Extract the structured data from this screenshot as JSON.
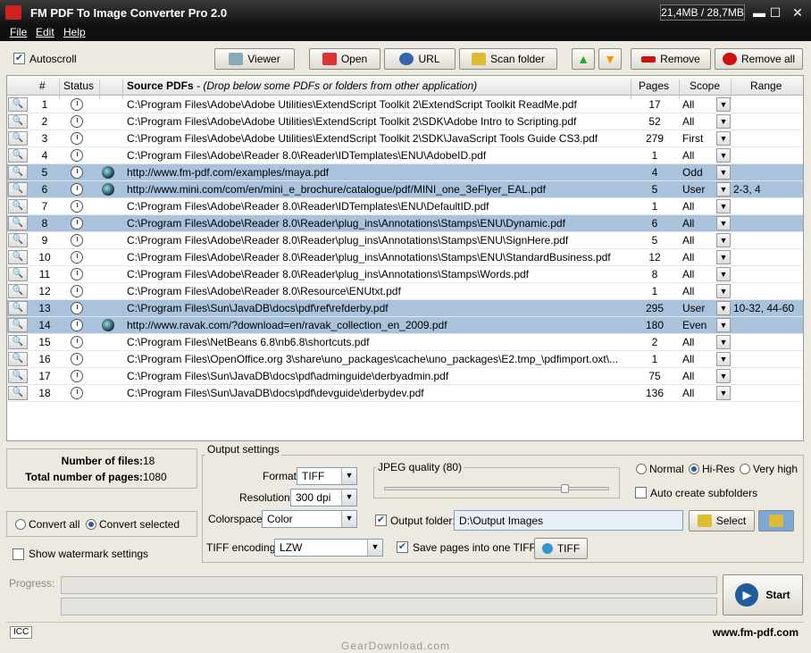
{
  "titlebar": {
    "title": "FM PDF To Image Converter Pro 2.0",
    "memory": "21,4MB / 28,7MB",
    "minimize": "▬",
    "maximize": "☐",
    "close": "✕"
  },
  "menu": {
    "file": "File",
    "edit": "Edit",
    "help": "Help"
  },
  "toolbar": {
    "autoscroll": "Autoscroll",
    "viewer": "Viewer",
    "open": "Open",
    "url": "URL",
    "scan_folder": "Scan folder",
    "move_up": "▲",
    "move_down": "▼",
    "remove": "Remove",
    "remove_all": "Remove all"
  },
  "grid": {
    "headers": {
      "num": "#",
      "status": "Status",
      "source": "Source PDFs",
      "hint": " - (Drop below some PDFs or folders from other application)",
      "pages": "Pages",
      "scope": "Scope",
      "range": "Range"
    },
    "rows": [
      {
        "num": "1",
        "path": "C:\\Program Files\\Adobe\\Adobe Utilities\\ExtendScript Toolkit 2\\ExtendScript Toolkit ReadMe.pdf",
        "pages": "17",
        "scope": "All",
        "range": "",
        "selected": false,
        "web": false
      },
      {
        "num": "2",
        "path": "C:\\Program Files\\Adobe\\Adobe Utilities\\ExtendScript Toolkit 2\\SDK\\Adobe Intro to Scripting.pdf",
        "pages": "52",
        "scope": "All",
        "range": "",
        "selected": false,
        "web": false
      },
      {
        "num": "3",
        "path": "C:\\Program Files\\Adobe\\Adobe Utilities\\ExtendScript Toolkit 2\\SDK\\JavaScript Tools Guide CS3.pdf",
        "pages": "279",
        "scope": "First",
        "range": "",
        "selected": false,
        "web": false
      },
      {
        "num": "4",
        "path": "C:\\Program Files\\Adobe\\Reader 8.0\\Reader\\IDTemplates\\ENU\\AdobeID.pdf",
        "pages": "1",
        "scope": "All",
        "range": "",
        "selected": false,
        "web": false
      },
      {
        "num": "5",
        "path": "http://www.fm-pdf.com/examples/maya.pdf",
        "pages": "4",
        "scope": "Odd",
        "range": "",
        "selected": true,
        "web": true
      },
      {
        "num": "6",
        "path": "http://www.mini.com/com/en/mini_e_brochure/catalogue/pdf/MINI_one_3eFlyer_EAL.pdf",
        "pages": "5",
        "scope": "User",
        "range": "2-3, 4",
        "selected": true,
        "web": true
      },
      {
        "num": "7",
        "path": "C:\\Program Files\\Adobe\\Reader 8.0\\Reader\\IDTemplates\\ENU\\DefaultID.pdf",
        "pages": "1",
        "scope": "All",
        "range": "",
        "selected": false,
        "web": false
      },
      {
        "num": "8",
        "path": "C:\\Program Files\\Adobe\\Reader 8.0\\Reader\\plug_ins\\Annotations\\Stamps\\ENU\\Dynamic.pdf",
        "pages": "6",
        "scope": "All",
        "range": "",
        "selected": true,
        "web": false
      },
      {
        "num": "9",
        "path": "C:\\Program Files\\Adobe\\Reader 8.0\\Reader\\plug_ins\\Annotations\\Stamps\\ENU\\SignHere.pdf",
        "pages": "5",
        "scope": "All",
        "range": "",
        "selected": false,
        "web": false
      },
      {
        "num": "10",
        "path": "C:\\Program Files\\Adobe\\Reader 8.0\\Reader\\plug_ins\\Annotations\\Stamps\\ENU\\StandardBusiness.pdf",
        "pages": "12",
        "scope": "All",
        "range": "",
        "selected": false,
        "web": false
      },
      {
        "num": "11",
        "path": "C:\\Program Files\\Adobe\\Reader 8.0\\Reader\\plug_ins\\Annotations\\Stamps\\Words.pdf",
        "pages": "8",
        "scope": "All",
        "range": "",
        "selected": false,
        "web": false
      },
      {
        "num": "12",
        "path": "C:\\Program Files\\Adobe\\Reader 8.0\\Resource\\ENUtxt.pdf",
        "pages": "1",
        "scope": "All",
        "range": "",
        "selected": false,
        "web": false
      },
      {
        "num": "13",
        "path": "C:\\Program Files\\Sun\\JavaDB\\docs\\pdf\\ref\\refderby.pdf",
        "pages": "295",
        "scope": "User",
        "range": "10-32, 44-60",
        "selected": true,
        "web": false
      },
      {
        "num": "14",
        "path": "http://www.ravak.com/?download=en/ravak_collection_en_2009.pdf",
        "pages": "180",
        "scope": "Even",
        "range": "",
        "selected": true,
        "web": true
      },
      {
        "num": "15",
        "path": "C:\\Program Files\\NetBeans 6.8\\nb6.8\\shortcuts.pdf",
        "pages": "2",
        "scope": "All",
        "range": "",
        "selected": false,
        "web": false
      },
      {
        "num": "16",
        "path": "C:\\Program Files\\OpenOffice.org 3\\share\\uno_packages\\cache\\uno_packages\\E2.tmp_\\pdfimport.oxt\\...",
        "pages": "1",
        "scope": "All",
        "range": "",
        "selected": false,
        "web": false
      },
      {
        "num": "17",
        "path": "C:\\Program Files\\Sun\\JavaDB\\docs\\pdf\\adminguide\\derbyadmin.pdf",
        "pages": "75",
        "scope": "All",
        "range": "",
        "selected": false,
        "web": false
      },
      {
        "num": "18",
        "path": "C:\\Program Files\\Sun\\JavaDB\\docs\\pdf\\devguide\\derbydev.pdf",
        "pages": "136",
        "scope": "All",
        "range": "",
        "selected": false,
        "web": false
      }
    ]
  },
  "stats": {
    "files_label": "Number of files:",
    "files_value": "18",
    "pages_label": "Total number of pages:",
    "pages_value": "1080"
  },
  "convert": {
    "all": "Convert all",
    "selected": "Convert selected",
    "mode": "selected"
  },
  "watermark": {
    "label": "Show watermark settings"
  },
  "output": {
    "legend": "Output settings",
    "format_label": "Format:",
    "format_value": "TIFF",
    "resolution_label": "Resolution:",
    "resolution_value": "300 dpi",
    "colorspace_label": "Colorspace:",
    "colorspace_value": "Color",
    "tiff_encoding_label": "TIFF encoding:",
    "tiff_encoding_value": "LZW",
    "jpeg_quality": "JPEG quality (80)",
    "jpeg_quality_level": 0.8,
    "quality_normal": "Normal",
    "quality_hires": "Hi-Res",
    "quality_veryhigh": "Very high",
    "auto_subfolders": "Auto create subfolders",
    "folder_label": "Output folder:",
    "folder_value": "D:\\Output Images",
    "select": "Select",
    "save_one_tiff": "Save pages into one TIFF",
    "tiff_button": "TIFF"
  },
  "progress": {
    "label": "Progress:",
    "start": "Start"
  },
  "status": {
    "icc": "ICC",
    "site": "www.fm-pdf.com"
  },
  "watermark_text": "GearDownload.com"
}
